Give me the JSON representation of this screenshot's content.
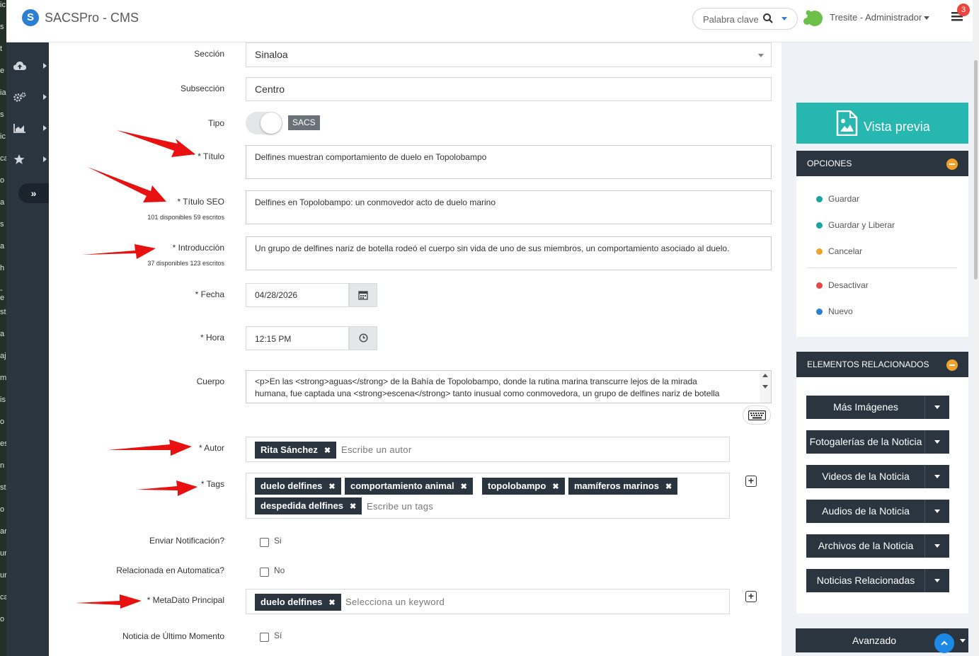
{
  "behind_text": [
    "ic",
    "s",
    "t",
    "e",
    "ia",
    "s",
    "ic",
    "ca",
    "o",
    "a",
    "s",
    "a",
    "h",
    "-e",
    "st",
    "a",
    "aj",
    "m",
    "is",
    "o",
    "es",
    "n",
    "st",
    "o",
    "ar",
    "ur",
    "ur",
    "ca",
    "o"
  ],
  "app": {
    "title": "SACSPro - CMS",
    "logo_letter": "S"
  },
  "header": {
    "search_placeholder": "Palabra clave",
    "user_name": "Tresite - Administrador",
    "notification_count": "3"
  },
  "sidenav": {
    "items": [
      {
        "icon": "cloud-upload-icon"
      },
      {
        "icon": "gears-icon"
      },
      {
        "icon": "area-chart-icon"
      },
      {
        "icon": "star-icon"
      }
    ],
    "collapse_label": "»"
  },
  "form": {
    "seccion": {
      "label": "Sección",
      "value": "Sinaloa"
    },
    "subseccion": {
      "label": "Subsección",
      "value": "Centro"
    },
    "tipo": {
      "label": "Tipo",
      "badge": "SACS"
    },
    "titulo": {
      "label": "* Título",
      "value": "Delfines muestran comportamiento de duelo en Topolobampo"
    },
    "titulo_seo": {
      "label": "* Título SEO",
      "counter": "101 disponibles 59 escritos",
      "value": "Delfines en Topolobampo: un conmovedor acto de duelo marino"
    },
    "introduccion": {
      "label": "* Introducción",
      "counter": "37 disponibles 123 escritos",
      "value": "Un grupo de delfines nariz de botella rodeó el cuerpo sin vida de uno de sus miembros, un comportamiento asociado al duelo."
    },
    "fecha": {
      "label": "* Fecha",
      "value": "04/28/2026"
    },
    "hora": {
      "label": "* Hora",
      "value": "12:15 PM"
    },
    "cuerpo": {
      "label": "Cuerpo",
      "line1": "<p>En las <strong>aguas</strong> de la Bahía de Topolobampo, donde la rutina marina transcurre lejos de la mirada",
      "line2": "humana, fue captada una <strong>escena</strong> tanto inusual como conmovedora, un grupo de delfines nariz de botella"
    },
    "autor": {
      "label": "* Autor",
      "chips": [
        "Rita Sánchez"
      ],
      "placeholder": "Escribe un autor"
    },
    "tags": {
      "label": "* Tags",
      "chips": [
        "duelo delfines",
        "comportamiento animal",
        "topolobampo",
        "mamíferos marinos",
        "despedida delfines"
      ],
      "placeholder": "Escribe un tags"
    },
    "enviar_notificacion": {
      "label": "Enviar Notificación?",
      "option": "Si"
    },
    "relacionada": {
      "label": "Relacionada en Automatica?",
      "option": "No"
    },
    "metadato": {
      "label": "* MetaDato Principal",
      "chips": [
        "duelo delfines"
      ],
      "placeholder": "Selecciona un keyword"
    },
    "ultimo_momento": {
      "label": "Noticia de Último Momento",
      "option": "Sí"
    }
  },
  "right": {
    "preview_label": "Vista previa",
    "opciones": {
      "title": "OPCIONES",
      "items": [
        {
          "label": "Guardar",
          "color": "#1aa5a0"
        },
        {
          "label": "Guardar y Liberar",
          "color": "#1aa5a0"
        },
        {
          "label": "Cancelar",
          "color": "#f0a12b"
        },
        {
          "label": "Desactivar",
          "color": "#e9463f"
        },
        {
          "label": "Nuevo",
          "color": "#2d7fd3"
        }
      ]
    },
    "relacionados": {
      "title": "ELEMENTOS RELACIONADOS",
      "buttons": [
        "Más Imágenes",
        "Fotogalerías de la Noticia",
        "Videos de la Noticia",
        "Audios de la Noticia",
        "Archivos de la Noticia",
        "Noticias Relacionadas"
      ]
    },
    "avanzado_label": "Avanzado"
  }
}
